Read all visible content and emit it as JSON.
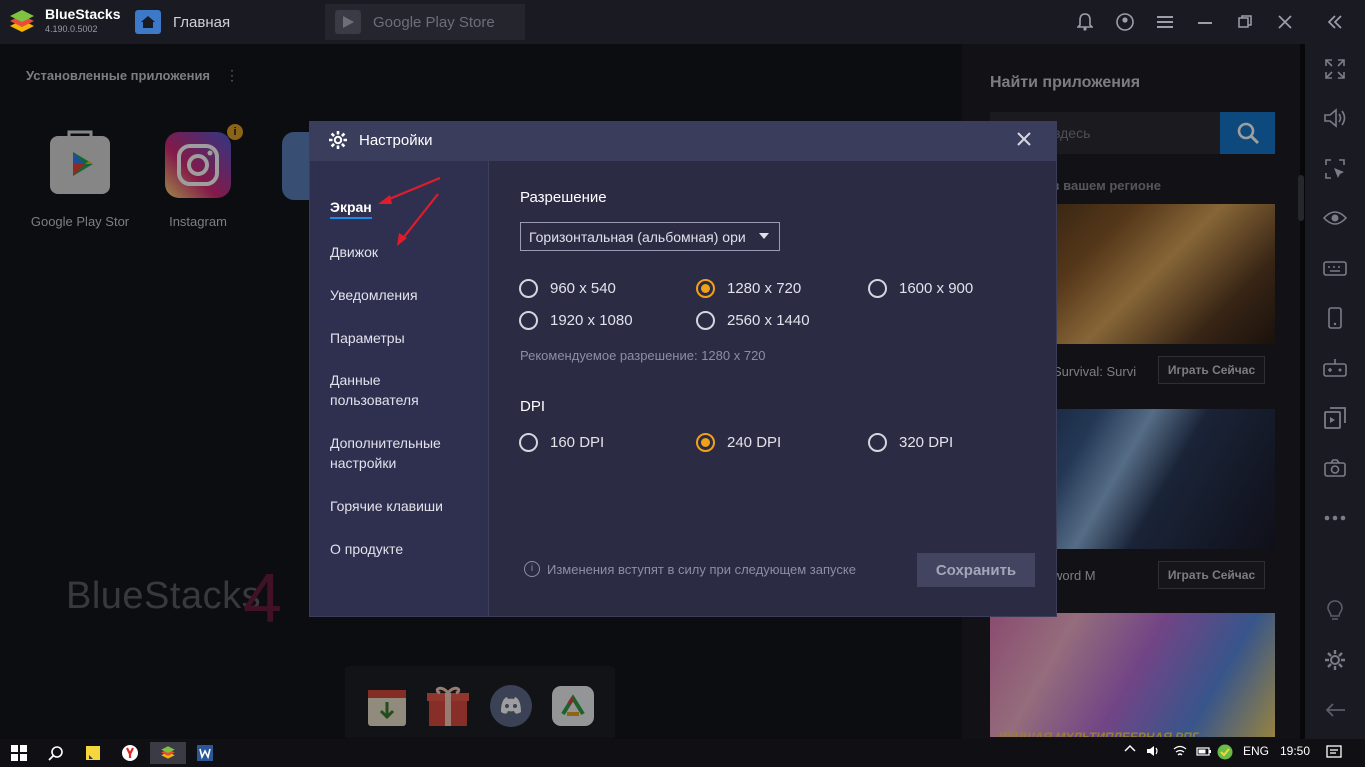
{
  "app": {
    "name": "BlueStacks",
    "version": "4.190.0.5002",
    "tabs": [
      {
        "label": "Главная",
        "icon": "home-icon"
      },
      {
        "label": "Google Play Store",
        "icon": "play-store-icon"
      }
    ],
    "window_controls": [
      "bell-icon",
      "account-icon",
      "menu-icon",
      "minimize-icon",
      "restore-icon",
      "close-icon",
      "collapse-icon"
    ]
  },
  "main": {
    "installed_title": "Установленные приложения",
    "apps": [
      {
        "label": "Google Play Stor",
        "icon": "google-play-icon"
      },
      {
        "label": "Instagram",
        "icon": "instagram-icon"
      }
    ],
    "watermark": "BlueStacks",
    "watermark_version": "4",
    "dock": [
      "gift-store-icon",
      "gift-icon",
      "discord-icon",
      "app-center-icon"
    ]
  },
  "right_panel": {
    "title": "Найти приложения",
    "search_placeholder": "здесь",
    "region_label": "о в вашем регионе",
    "cards": [
      {
        "name": "Survival: Survi",
        "button": "Играть Сейчас"
      },
      {
        "name": "word M",
        "button": "Играть Сейчас"
      },
      {
        "name": "",
        "button": ""
      }
    ],
    "card3_caption": "ЛУЧШАЯ МУЛЬТИПЛЕЕРНАЯ РПГ"
  },
  "sidebar_icons": [
    "fullscreen-icon",
    "volume-icon",
    "select-icon",
    "eye-icon",
    "keyboard-icon",
    "phone-icon",
    "gamepad-icon",
    "import-icon",
    "camera-icon",
    "more-icon",
    "bulb-icon",
    "settings-icon",
    "back-icon"
  ],
  "dialog": {
    "title": "Настройки",
    "nav": [
      {
        "label": "Экран",
        "active": true
      },
      {
        "label": "Движок"
      },
      {
        "label": "Уведомления"
      },
      {
        "label": "Параметры"
      },
      {
        "label": "Данные пользователя"
      },
      {
        "label": "Дополнительные настройки"
      },
      {
        "label": "Горячие клавиши"
      },
      {
        "label": "О продукте"
      }
    ],
    "resolution": {
      "title": "Разрешение",
      "orientation": "Горизонтальная (альбомная) ори",
      "options": [
        "960 x 540",
        "1280 x 720",
        "1600 x 900",
        "1920 x 1080",
        "2560 x 1440"
      ],
      "selected": "1280 x 720",
      "recommended": "Рекомендуемое разрешение: 1280 x 720"
    },
    "dpi": {
      "title": "DPI",
      "options": [
        "160 DPI",
        "240 DPI",
        "320 DPI"
      ],
      "selected": "240 DPI"
    },
    "note": "Изменения вступят в силу при следующем запуске",
    "save_label": "Сохранить"
  },
  "taskbar": {
    "language": "ENG",
    "time": "19:50"
  },
  "colors": {
    "accent_orange": "#f0a11a",
    "accent_blue": "#1a8be8",
    "dialog_bg": "#2b2c44",
    "annotation_red": "#e11c2a"
  }
}
